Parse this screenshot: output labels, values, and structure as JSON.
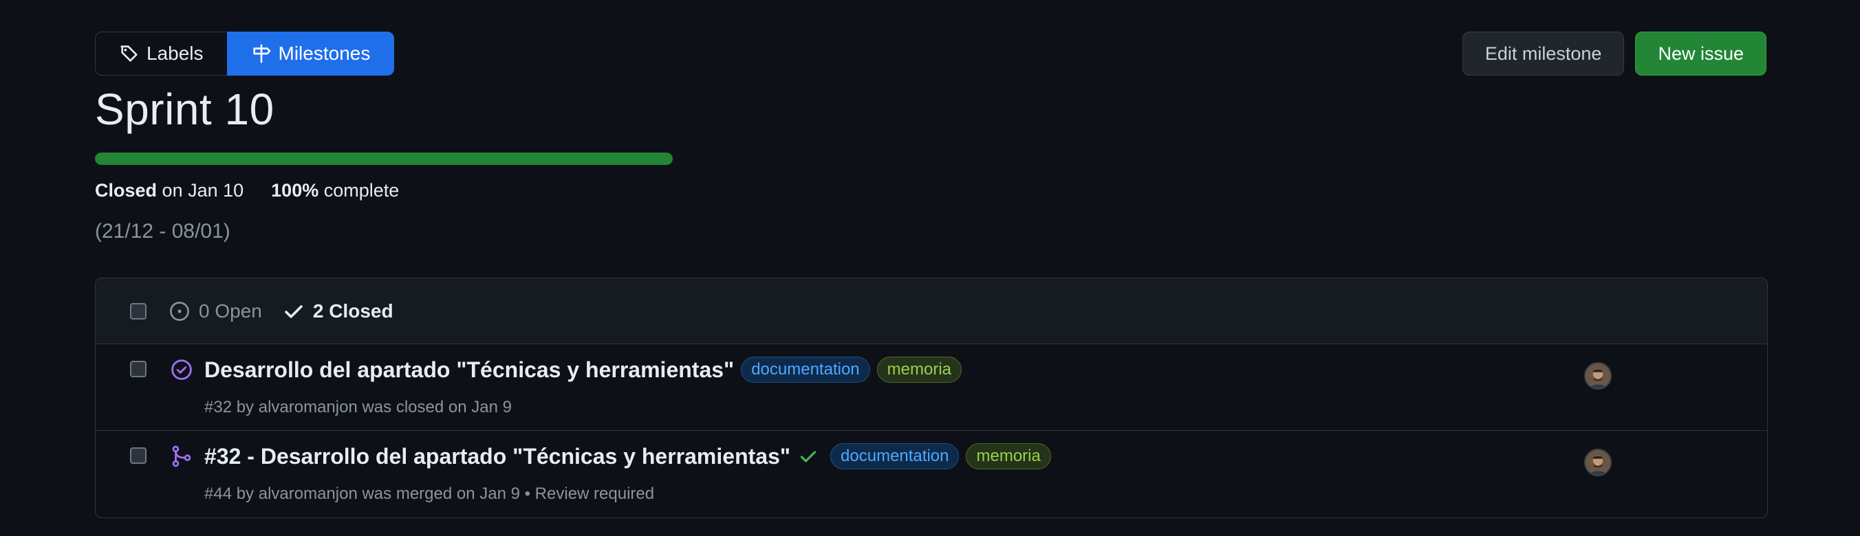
{
  "nav": {
    "labels": "Labels",
    "milestones": "Milestones"
  },
  "actions": {
    "edit": "Edit milestone",
    "new_issue": "New issue"
  },
  "milestone": {
    "title": "Sprint 10",
    "progress_percent": 100,
    "closed_word": "Closed",
    "closed_date": "on Jan 10",
    "complete_percent": "100%",
    "complete_word": "complete",
    "description": "(21/12 - 08/01)"
  },
  "issues_header": {
    "open": "0 Open",
    "closed": "2 Closed"
  },
  "issues": [
    {
      "title": "Desarrollo del apartado \"Técnicas y herramientas\"",
      "labels": [
        "documentation",
        "memoria"
      ],
      "subtitle": "#32 by alvaromanjon was closed on Jan 9",
      "type": "issue-closed"
    },
    {
      "title": "#32 - Desarrollo del apartado \"Técnicas y herramientas\"",
      "labels": [
        "documentation",
        "memoria"
      ],
      "subtitle": "#44 by alvaromanjon was merged on Jan 9 • Review required",
      "type": "pull-request-merged"
    }
  ],
  "colors": {
    "accent": "#1f6feb",
    "success": "#238636",
    "merged": "#a371f7",
    "background": "#0d1117"
  }
}
